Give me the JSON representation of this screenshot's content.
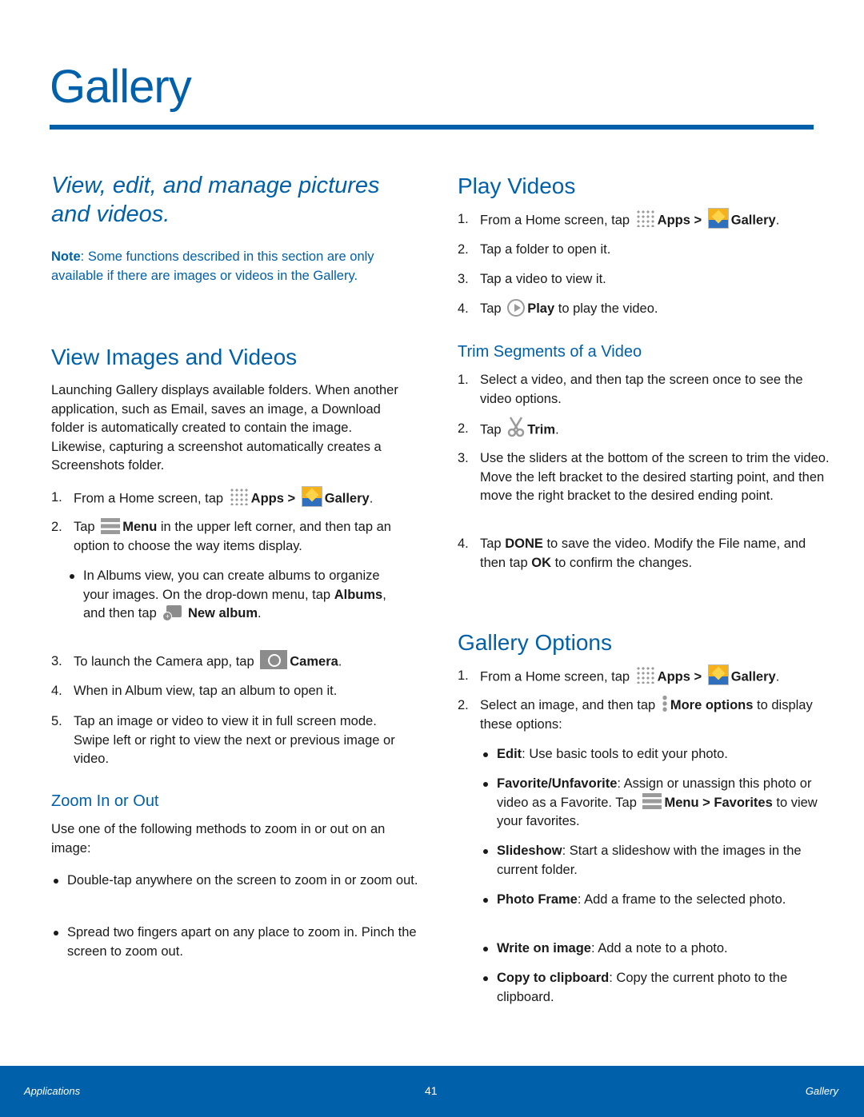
{
  "page": {
    "title": "Gallery",
    "intro": "View, edit, and manage pictures and videos.",
    "note": {
      "label": "Note",
      "text": ": Some functions described in this section are only available if there are images or videos in the Gallery."
    }
  },
  "view_images": {
    "heading": "View Images and Videos",
    "paragraph": "Launching Gallery displays available folders. When another application, such as Email, saves an image, a Download folder is automatically created to contain the image. Likewise, capturing a screenshot automatically creates a Screenshots folder.",
    "steps": [
      {
        "num": "1.",
        "pre": "From a Home screen, tap",
        "apps": "Apps",
        "sep": ">",
        "gallery": "Gallery",
        "post": "."
      },
      {
        "num": "2.",
        "pre": "Tap",
        "bold": "Menu",
        "post": "in the upper left corner, and then tap an option to choose the way items display."
      },
      {
        "num": "3.",
        "pre": "To launch the Camera app, tap",
        "bold": "Camera",
        "post": "."
      },
      {
        "num": "4.",
        "text": "When in Album view, tap an album to open it."
      },
      {
        "num": "5.",
        "text": "Tap an image or video to view it in full screen mode. Swipe left or right to view the next or previous image or video."
      }
    ],
    "bullet": {
      "pre": "In Albums view, you can create albums to organize your images. On the drop-down menu, tap",
      "bold1": "Albums",
      "mid": ", and then tap",
      "bold2": "New album",
      "post": "."
    }
  },
  "zoom": {
    "heading": "Zoom In or Out",
    "paragraph": "Use one of the following methods to zoom in or out on an image:",
    "bullets": [
      "Double-tap anywhere on the screen to zoom in or zoom out.",
      "Spread two fingers apart on any place to zoom in. Pinch the screen to zoom out."
    ]
  },
  "play_videos": {
    "heading": "Play Videos",
    "steps": [
      {
        "num": "1.",
        "pre": "From a Home screen, tap",
        "apps": "Apps",
        "sep": ">",
        "gallery": "Gallery",
        "post": "."
      },
      {
        "num": "2.",
        "text": "Tap a folder to open it."
      },
      {
        "num": "3.",
        "text": "Tap a video to view it."
      },
      {
        "num": "4.",
        "pre": "Tap",
        "bold": "Play",
        "post": "to play the video."
      }
    ]
  },
  "trim": {
    "heading": "Trim Segments of a Video",
    "steps": [
      {
        "num": "1.",
        "text": "Select a video, and then tap the screen once to see the video options."
      },
      {
        "num": "2.",
        "pre": "Tap",
        "bold": "Trim",
        "post": "."
      },
      {
        "num": "3.",
        "text": "Use the sliders at the bottom of the screen to trim the video. Move the left bracket to the desired starting point, and then move the right bracket to the desired ending point."
      },
      {
        "num": "4.",
        "pre": "Tap",
        "bold1": "DONE",
        "mid": "to save the video. Modify the File name, and then tap",
        "bold2": "OK",
        "post": "to confirm the changes."
      }
    ]
  },
  "options": {
    "heading": "Gallery Options",
    "steps": [
      {
        "num": "1.",
        "pre": "From a Home screen, tap",
        "apps": "Apps",
        "sep": ">",
        "gallery": "Gallery",
        "post": "."
      },
      {
        "num": "2.",
        "pre": "Select an image, and then tap",
        "bold": "More options",
        "post": "to display these options:"
      }
    ],
    "bullets": [
      {
        "label": "Edit",
        "text": ": Use basic tools to edit your photo."
      },
      {
        "label": "Favorite/Unfavorite",
        "text": ": Assign or unassign this photo or video as a Favorite. Tap",
        "bold2": "Menu >",
        "bold3": "Favorites",
        "post": "to view your favorites."
      },
      {
        "label": "Slideshow",
        "text": ": Start a slideshow with the images in the current folder."
      },
      {
        "label": "Photo Frame",
        "text": ": Add a frame to the selected photo."
      },
      {
        "label": "Write on image",
        "text": ": Add a note to a photo."
      },
      {
        "label": "Copy to clipboard",
        "text": ": Copy the current photo to the clipboard."
      }
    ]
  },
  "footer": {
    "left": "Applications",
    "page_number": "41",
    "right": "Gallery"
  },
  "colors": {
    "accent": "#0060a9",
    "text": "#1a1a1a",
    "icon_gray": "#9a9a9a"
  }
}
